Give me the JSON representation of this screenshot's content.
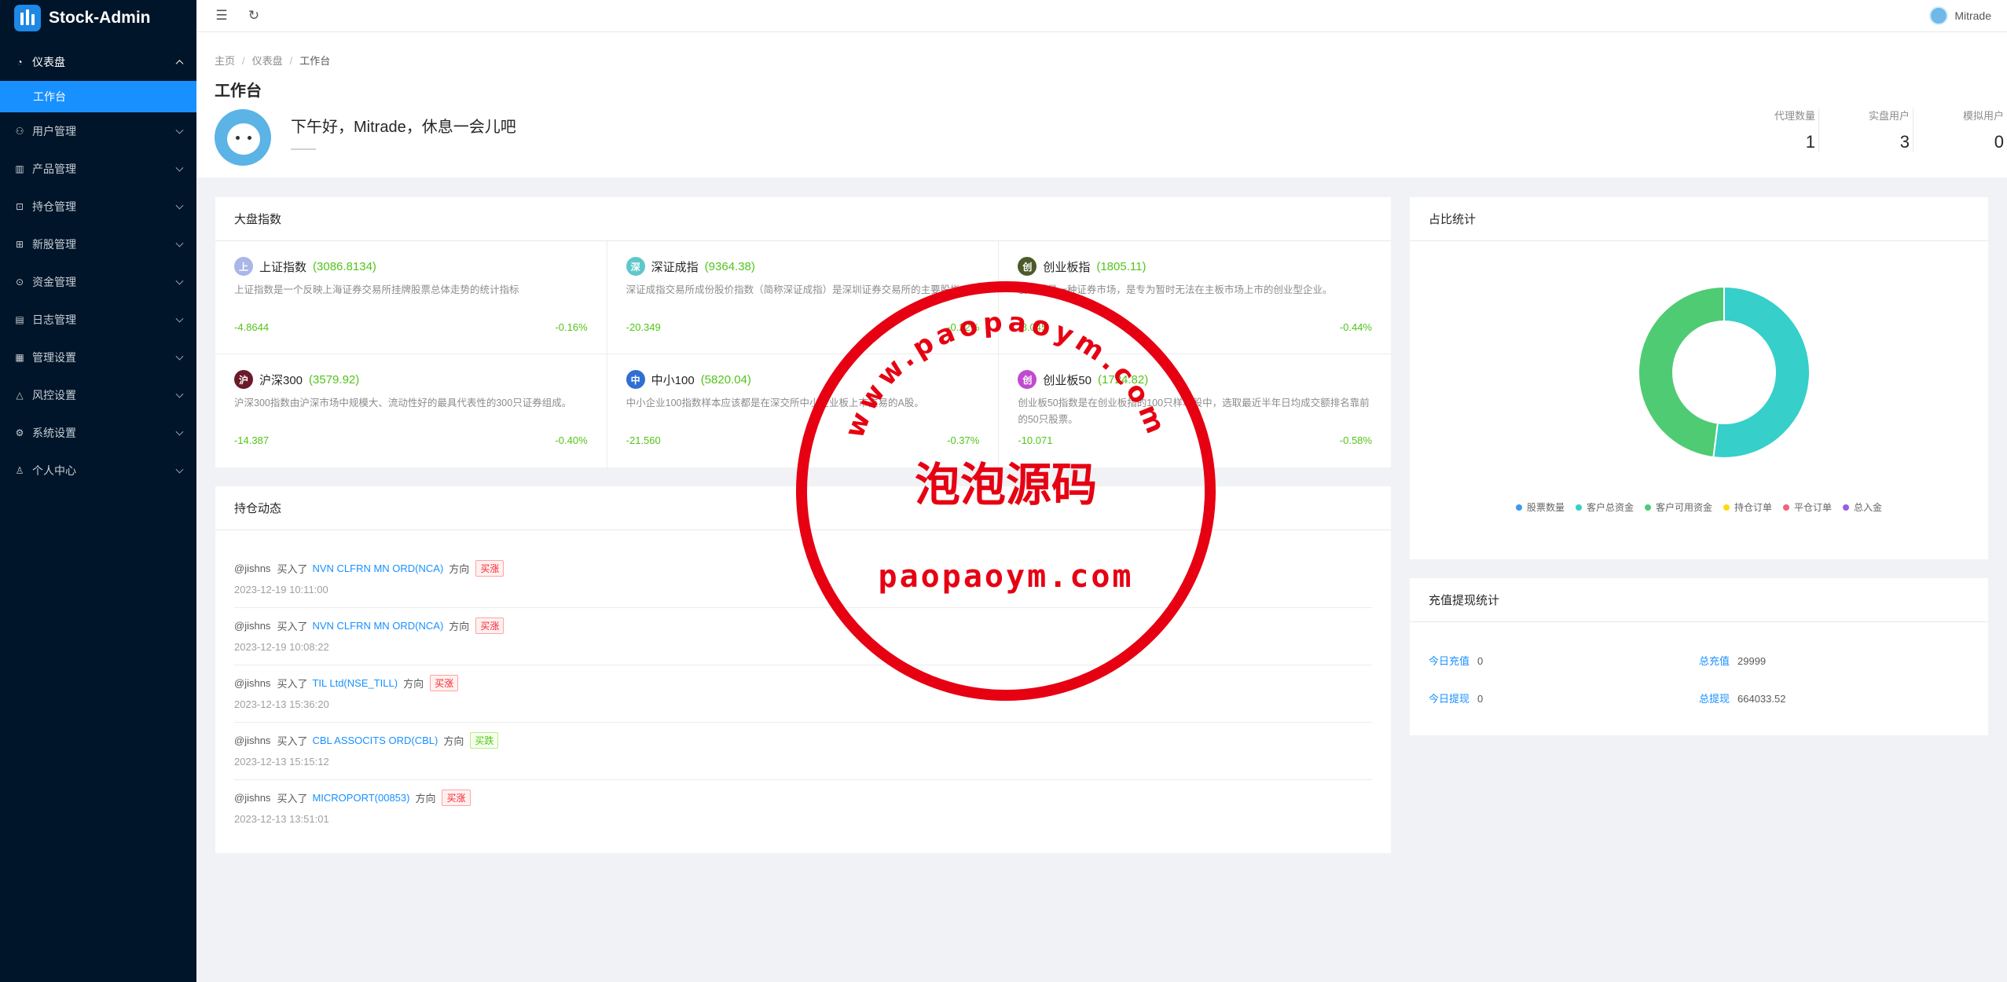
{
  "app": {
    "name": "Stock-Admin"
  },
  "sidebar": {
    "items": [
      {
        "label": "仪表盘",
        "icon": "dashboard-icon",
        "open": true
      },
      {
        "label": "用户管理",
        "icon": "users-icon"
      },
      {
        "label": "产品管理",
        "icon": "chart-icon"
      },
      {
        "label": "持仓管理",
        "icon": "position-icon"
      },
      {
        "label": "新股管理",
        "icon": "ipo-icon"
      },
      {
        "label": "资金管理",
        "icon": "money-icon"
      },
      {
        "label": "日志管理",
        "icon": "log-icon"
      },
      {
        "label": "管理设置",
        "icon": "admin-settings-icon"
      },
      {
        "label": "风控设置",
        "icon": "warning-icon"
      },
      {
        "label": "系统设置",
        "icon": "gear-icon"
      },
      {
        "label": "个人中心",
        "icon": "user-icon"
      }
    ],
    "sub_active": "工作台"
  },
  "topbar": {
    "username": "Mitrade"
  },
  "breadcrumb": [
    "主页",
    "仪表盘",
    "工作台"
  ],
  "page_title": "工作台",
  "greeting": "下午好，Mitrade，休息一会儿吧",
  "greeting_sub": "——",
  "stats": [
    {
      "label": "代理数量",
      "value": "1"
    },
    {
      "label": "实盘用户",
      "value": "3"
    },
    {
      "label": "模拟用户",
      "value": "0"
    }
  ],
  "indices_card": {
    "title": "大盘指数",
    "items": [
      {
        "badge": "上",
        "color": "#a9b7e8",
        "name": "上证指数",
        "value": "(3086.8134)",
        "desc": "上证指数是一个反映上海证券交易所挂牌股票总体走势的统计指标",
        "change": "-4.8644",
        "pct": "-0.16%"
      },
      {
        "badge": "深",
        "color": "#5ec7c9",
        "name": "深证成指",
        "value": "(9364.38)",
        "desc": "深证成指交易所成份股价指数（简称深证成指）是深圳证券交易所的主要股指。",
        "change": "-20.349",
        "pct": "-0.22%"
      },
      {
        "badge": "创",
        "color": "#4a5a2a",
        "name": "创业板指",
        "value": "(1805.11)",
        "desc": "创业板是一种证券市场，是专为暂时无法在主板市场上市的创业型企业。",
        "change": "-8.045",
        "pct": "-0.44%"
      },
      {
        "badge": "沪",
        "color": "#6b1a2a",
        "name": "沪深300",
        "value": "(3579.92)",
        "desc": "沪深300指数由沪深市场中规模大、流动性好的最具代表性的300只证券组成。",
        "change": "-14.387",
        "pct": "-0.40%"
      },
      {
        "badge": "中",
        "color": "#2f6fd1",
        "name": "中小100",
        "value": "(5820.04)",
        "desc": "中小企业100指数样本应该都是在深交所中小企业板上市交易的A股。",
        "change": "-21.560",
        "pct": "-0.37%"
      },
      {
        "badge": "创",
        "color": "#c04ad0",
        "name": "创业板50",
        "value": "(1724.82)",
        "desc": "创业板50指数是在创业板指的100只样本股中，选取最近半年日均成交额排名靠前的50只股票。",
        "change": "-10.071",
        "pct": "-0.58%"
      }
    ]
  },
  "holdings_card": {
    "title": "持仓动态",
    "items": [
      {
        "user": "@jishns",
        "action": "买入了",
        "stock": "NVN CLFRN MN ORD(NCA)",
        "dir_label": "方向",
        "tag": "买涨",
        "tag_type": "up",
        "time": "2023-12-19 10:11:00"
      },
      {
        "user": "@jishns",
        "action": "买入了",
        "stock": "NVN CLFRN MN ORD(NCA)",
        "dir_label": "方向",
        "tag": "买涨",
        "tag_type": "up",
        "time": "2023-12-19 10:08:22"
      },
      {
        "user": "@jishns",
        "action": "买入了",
        "stock": "TIL Ltd(NSE_TILL)",
        "dir_label": "方向",
        "tag": "买涨",
        "tag_type": "up",
        "time": "2023-12-13 15:36:20"
      },
      {
        "user": "@jishns",
        "action": "买入了",
        "stock": "CBL ASSOCITS ORD(CBL)",
        "dir_label": "方向",
        "tag": "买跌",
        "tag_type": "down",
        "time": "2023-12-13 15:15:12"
      },
      {
        "user": "@jishns",
        "action": "买入了",
        "stock": "MICROPORT(00853)",
        "dir_label": "方向",
        "tag": "买涨",
        "tag_type": "up",
        "time": "2023-12-13 13:51:01"
      }
    ]
  },
  "ratio_card": {
    "title": "占比统计"
  },
  "chart_data": {
    "type": "pie",
    "series": [
      {
        "name": "股票数量",
        "value": 0,
        "color": "#3b9af0"
      },
      {
        "name": "客户总资金",
        "value": 52,
        "color": "#36cfc9"
      },
      {
        "name": "客户可用资金",
        "value": 48,
        "color": "#4fcb73"
      },
      {
        "name": "持仓订单",
        "value": 0,
        "color": "#fadb14"
      },
      {
        "name": "平仓订单",
        "value": 0,
        "color": "#f2637b"
      },
      {
        "name": "总入金",
        "value": 0,
        "color": "#975fe4"
      }
    ],
    "legend": "bottom"
  },
  "recharge_card": {
    "title": "充值提现统计",
    "today_recharge_label": "今日充值",
    "today_recharge": "0",
    "total_recharge_label": "总充值",
    "total_recharge": "29999",
    "today_withdraw_label": "今日提现",
    "today_withdraw": "0",
    "total_withdraw_label": "总提现",
    "total_withdraw": "664033.52"
  },
  "watermark": {
    "top_text": "www.paopaoym.com",
    "middle_text": "泡泡源码",
    "bottom_text": "paopaoym.com",
    "color": "#e60012"
  }
}
